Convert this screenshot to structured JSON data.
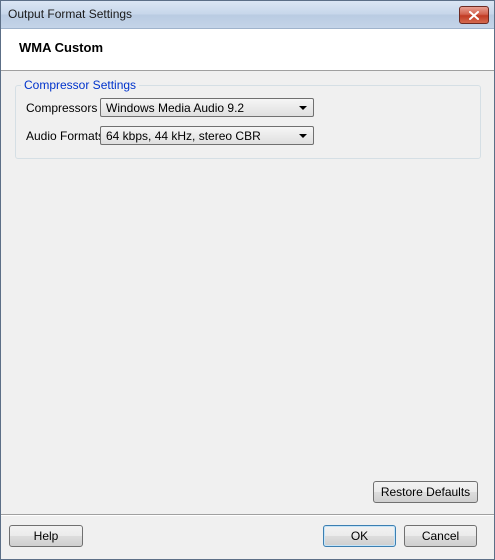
{
  "window": {
    "title": "Output Format Settings"
  },
  "header": {
    "heading": "WMA Custom"
  },
  "compressor_settings": {
    "legend": "Compressor Settings",
    "compressors": {
      "label": "Compressors",
      "value": "Windows Media Audio 9.2"
    },
    "audio_formats": {
      "label": "Audio Formats",
      "value": "64 kbps, 44 kHz, stereo CBR"
    }
  },
  "buttons": {
    "restore_defaults": "Restore Defaults",
    "help": "Help",
    "ok": "OK",
    "cancel": "Cancel"
  },
  "icons": {
    "close": "close-icon",
    "dropdown": "chevron-down-icon"
  },
  "colors": {
    "legend_text": "#0033cc",
    "close_button": "#c13b24"
  }
}
